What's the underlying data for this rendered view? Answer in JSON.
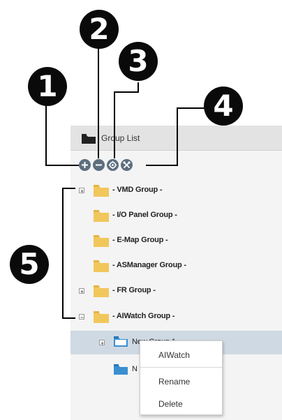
{
  "header": {
    "title": "Group List"
  },
  "toolbar": [
    {
      "name": "add-group-icon"
    },
    {
      "name": "remove-group-icon"
    },
    {
      "name": "settings-icon"
    },
    {
      "name": "tools-icon"
    }
  ],
  "callouts": [
    "1",
    "2",
    "3",
    "4",
    "5"
  ],
  "tree": [
    {
      "label": "- VMD Group -",
      "expander": true
    },
    {
      "label": "- I/O Panel Group -",
      "expander": false
    },
    {
      "label": "- E-Map Group -",
      "expander": false
    },
    {
      "label": "- ASManager Group -",
      "expander": false
    },
    {
      "label": "- FR Group -",
      "expander": true
    },
    {
      "label": "- AIWatch Group -",
      "expander": true,
      "expanded": true
    }
  ],
  "subtree": [
    {
      "label": "New Group 1",
      "expander": true,
      "selected": true
    },
    {
      "label": "N"
    }
  ],
  "context_menu": {
    "items": [
      "AIWatch",
      "Rename",
      "Delete"
    ]
  },
  "colors": {
    "callout": "#0a0a0a",
    "folder": "#f1c75c",
    "folder_blue": "#3a8fd0",
    "selection": "#cfd9e3",
    "toolbar_icon": "#5d6f7f"
  }
}
